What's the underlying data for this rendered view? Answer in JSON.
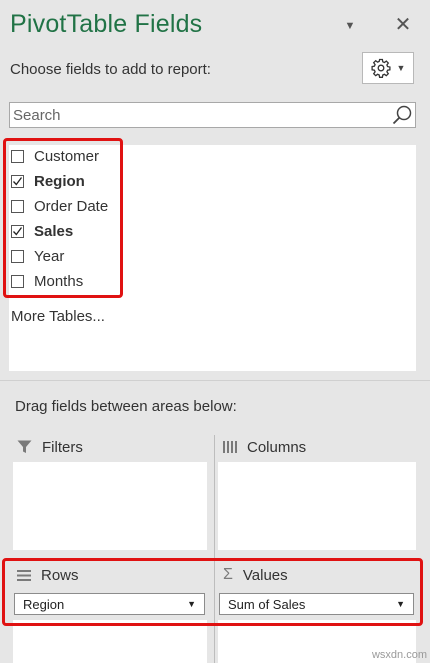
{
  "panel": {
    "title": "PivotTable Fields",
    "choose_label": "Choose fields to add to report:",
    "search_placeholder": "Search",
    "more_tables": "More Tables...",
    "drag_label": "Drag fields between areas below:"
  },
  "fields": [
    {
      "label": "Customer",
      "checked": false
    },
    {
      "label": "Region",
      "checked": true
    },
    {
      "label": "Order Date",
      "checked": false
    },
    {
      "label": "Sales",
      "checked": true
    },
    {
      "label": "Year",
      "checked": false
    },
    {
      "label": "Months",
      "checked": false
    }
  ],
  "areas": {
    "filters": {
      "label": "Filters",
      "icon": "filter-icon"
    },
    "columns": {
      "label": "Columns",
      "icon": "columns-icon"
    },
    "rows": {
      "label": "Rows",
      "icon": "rows-icon",
      "item": "Region"
    },
    "values": {
      "label": "Values",
      "icon": "sigma-icon",
      "item": "Sum of Sales"
    }
  },
  "colors": {
    "title": "#217346",
    "highlight": "#e01212",
    "background": "#e6e6e6"
  },
  "watermark": "wsxdn.com"
}
